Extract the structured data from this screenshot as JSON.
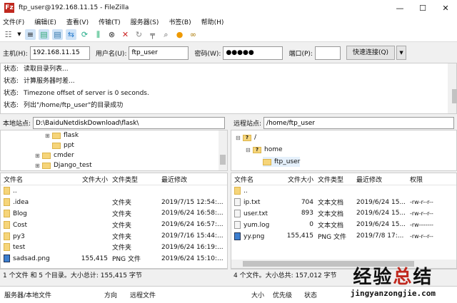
{
  "title": "ftp_user@192.168.11.15 - FileZilla",
  "logo_text": "Fz",
  "window_controls": [
    "—",
    "☐",
    "✕"
  ],
  "menu": [
    "文件(F)",
    "编辑(E)",
    "查看(V)",
    "传输(T)",
    "服务器(S)",
    "书签(B)",
    "帮助(H)"
  ],
  "quickconnect": {
    "host_label": "主机(H):",
    "host": "192.168.11.15",
    "user_label": "用户名(U):",
    "user": "ftp_user",
    "pass_label": "密码(W):",
    "pass": "●●●●●",
    "port_label": "端口(P):",
    "port": "",
    "connect": "快速连接(Q)",
    "dropdown": "▼"
  },
  "log": [
    {
      "k": "状态:",
      "v": "读取目录列表..."
    },
    {
      "k": "状态:",
      "v": "计算服务器时差..."
    },
    {
      "k": "状态:",
      "v": "Timezone offset of server is 0 seconds."
    },
    {
      "k": "状态:",
      "v": "列出\"/home/ftp_user\"的目录成功"
    }
  ],
  "local": {
    "label": "本地站点:",
    "path": "D:\\BaiduNetdiskDownload\\flask\\",
    "tree": [
      "flask",
      "ppt",
      "cmder",
      "Django_test"
    ],
    "headers": [
      "文件名",
      "文件大小",
      "文件类型",
      "最近修改"
    ],
    "rows": [
      {
        "n": "..",
        "s": "",
        "t": "",
        "d": "",
        "i": "folder"
      },
      {
        "n": ".idea",
        "s": "",
        "t": "文件夹",
        "d": "2019/7/15 12:54:...",
        "i": "folder"
      },
      {
        "n": "Blog",
        "s": "",
        "t": "文件夹",
        "d": "2019/6/24 16:58:...",
        "i": "folder"
      },
      {
        "n": "Cost",
        "s": "",
        "t": "文件夹",
        "d": "2019/6/24 16:57:...",
        "i": "folder"
      },
      {
        "n": "py3",
        "s": "",
        "t": "文件夹",
        "d": "2019/7/16 15:44:...",
        "i": "folder"
      },
      {
        "n": "test",
        "s": "",
        "t": "文件夹",
        "d": "2019/6/24 16:19:...",
        "i": "folder"
      },
      {
        "n": "sadsad.png",
        "s": "155,415",
        "t": "PNG 文件",
        "d": "2019/6/24 15:10:...",
        "i": "img"
      }
    ],
    "status": "1 个文件 和 5 个目录。大小总计: 155,415 字节"
  },
  "remote": {
    "label": "远程站点:",
    "path": "/home/ftp_user",
    "tree": [
      "/",
      "home",
      "ftp_user"
    ],
    "headers": [
      "文件名",
      "文件大小",
      "文件类型",
      "最近修改",
      "权限"
    ],
    "rows": [
      {
        "n": "..",
        "s": "",
        "t": "",
        "d": "",
        "p": "",
        "i": "folder"
      },
      {
        "n": "ip.txt",
        "s": "704",
        "t": "文本文档",
        "d": "2019/6/24 15...",
        "p": "-rw-r--r--",
        "i": "file"
      },
      {
        "n": "user.txt",
        "s": "893",
        "t": "文本文档",
        "d": "2019/6/24 15...",
        "p": "-rw-r--r--",
        "i": "file"
      },
      {
        "n": "yum.log",
        "s": "0",
        "t": "文本文档",
        "d": "2019/6/24 15...",
        "p": "-rw-------",
        "i": "file"
      },
      {
        "n": "yy.png",
        "s": "155,415",
        "t": "PNG 文件",
        "d": "2019/7/8 17:...",
        "p": "-rw-r--r--",
        "i": "img"
      }
    ],
    "status": "4 个文件。大小总共: 157,012 字节"
  },
  "queue": [
    "服务器/本地文件",
    "方向",
    "远程文件",
    "大小",
    "优先级",
    "状态"
  ],
  "watermark": {
    "a": "经验",
    "b": "总",
    "c": "结",
    "url": "jingyanzongjie.com"
  }
}
